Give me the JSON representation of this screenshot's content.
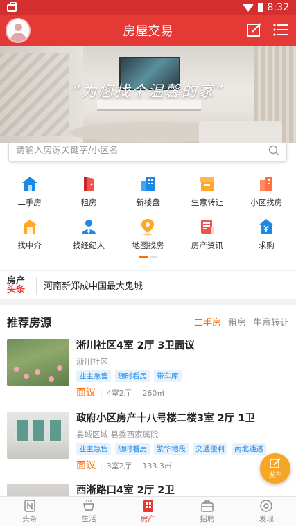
{
  "status_bar": {
    "time": "8:32"
  },
  "header": {
    "title": "房屋交易"
  },
  "banner": {
    "slogan": "“为您找个温馨的家”"
  },
  "search": {
    "placeholder": "请输入房源关键字/小区名"
  },
  "nav": [
    {
      "label": "二手房",
      "icon": "house-icon",
      "color": "#1e88e5"
    },
    {
      "label": "租房",
      "icon": "door-icon",
      "color": "#ef5350"
    },
    {
      "label": "新楼盘",
      "icon": "building-icon",
      "color": "#1e88e5"
    },
    {
      "label": "生意转让",
      "icon": "shop-icon",
      "color": "#ffa726"
    },
    {
      "label": "小区找房",
      "icon": "apartment-icon",
      "color": "#ff7043"
    },
    {
      "label": "找中介",
      "icon": "agency-icon",
      "color": "#ffa726"
    },
    {
      "label": "找经纪人",
      "icon": "agent-icon",
      "color": "#1e88e5"
    },
    {
      "label": "地图找房",
      "icon": "map-pin-icon",
      "color": "#ffa726"
    },
    {
      "label": "房产资讯",
      "icon": "news-icon",
      "color": "#ef5350"
    },
    {
      "label": "求购",
      "icon": "yen-icon",
      "color": "#1e88e5"
    }
  ],
  "headline": {
    "logo_line1": "房产",
    "logo_line2": "头条",
    "text": "河南新郑成中国最大鬼城"
  },
  "recommend": {
    "title": "推荐房源",
    "tabs": [
      "二手房",
      "租房",
      "生意转让"
    ]
  },
  "listings": [
    {
      "title": "淅川社区4室 2厅 3卫面议",
      "area": "淅川社区",
      "tags": [
        "业主急售",
        "随时看房",
        "带车库"
      ],
      "price": "面议",
      "layout": "4室2厅",
      "size": "260㎡"
    },
    {
      "title": "政府小区房产十八号楼二楼3室 2厅 1卫",
      "area": "县城区域  县委西家属院",
      "tags": [
        "业主急售",
        "随时看房",
        "繁华地段",
        "交通便利",
        "南北通透"
      ],
      "price": "面议",
      "layout": "3室2厅",
      "size": "133.3㎡"
    },
    {
      "title": "西淅路口4室 2厅 2卫",
      "area": "",
      "tags": [],
      "price": "",
      "layout": "",
      "size": ""
    }
  ],
  "fab": {
    "label": "发布"
  },
  "tabbar": [
    {
      "label": "头条",
      "icon": "news-icon",
      "active": false
    },
    {
      "label": "生活",
      "icon": "cup-icon",
      "active": false
    },
    {
      "label": "房产",
      "icon": "building-icon",
      "active": true
    },
    {
      "label": "招聘",
      "icon": "briefcase-icon",
      "active": false
    },
    {
      "label": "发现",
      "icon": "compass-icon",
      "active": false
    }
  ],
  "colors": {
    "primary": "#e53935",
    "accent": "#ff6a00",
    "tag_blue": "#1e88e5",
    "fab": "#f6a623"
  }
}
